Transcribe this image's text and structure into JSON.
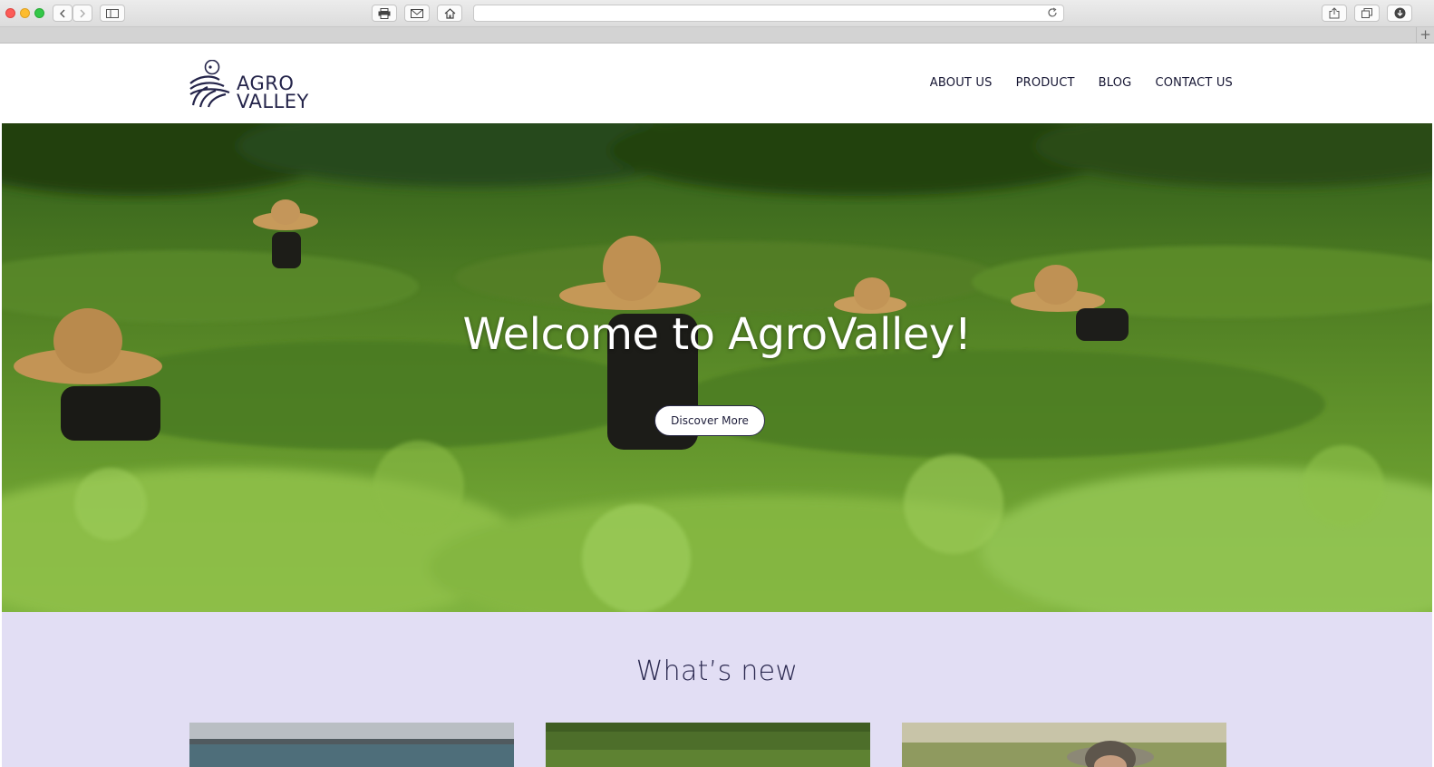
{
  "brand": {
    "name_line1": "AGRO",
    "name_line2": "VALLEY"
  },
  "nav": {
    "items": [
      {
        "label": "ABOUT US"
      },
      {
        "label": "PRODUCT"
      },
      {
        "label": "BLOG"
      },
      {
        "label": "CONTACT US"
      }
    ]
  },
  "hero": {
    "title": "Welcome to AgroValley!",
    "cta_label": "Discover More"
  },
  "news": {
    "title": "What’s new"
  },
  "colors": {
    "brand_navy": "#24244a",
    "news_background": "#e2def4",
    "hero_green": "#5e8f2a"
  },
  "icons": {
    "toolbar": [
      "back-icon",
      "forward-icon",
      "sidebar-icon",
      "print-icon",
      "mail-icon",
      "home-icon",
      "reload-icon",
      "share-icon",
      "tabs-icon",
      "download-icon"
    ]
  }
}
